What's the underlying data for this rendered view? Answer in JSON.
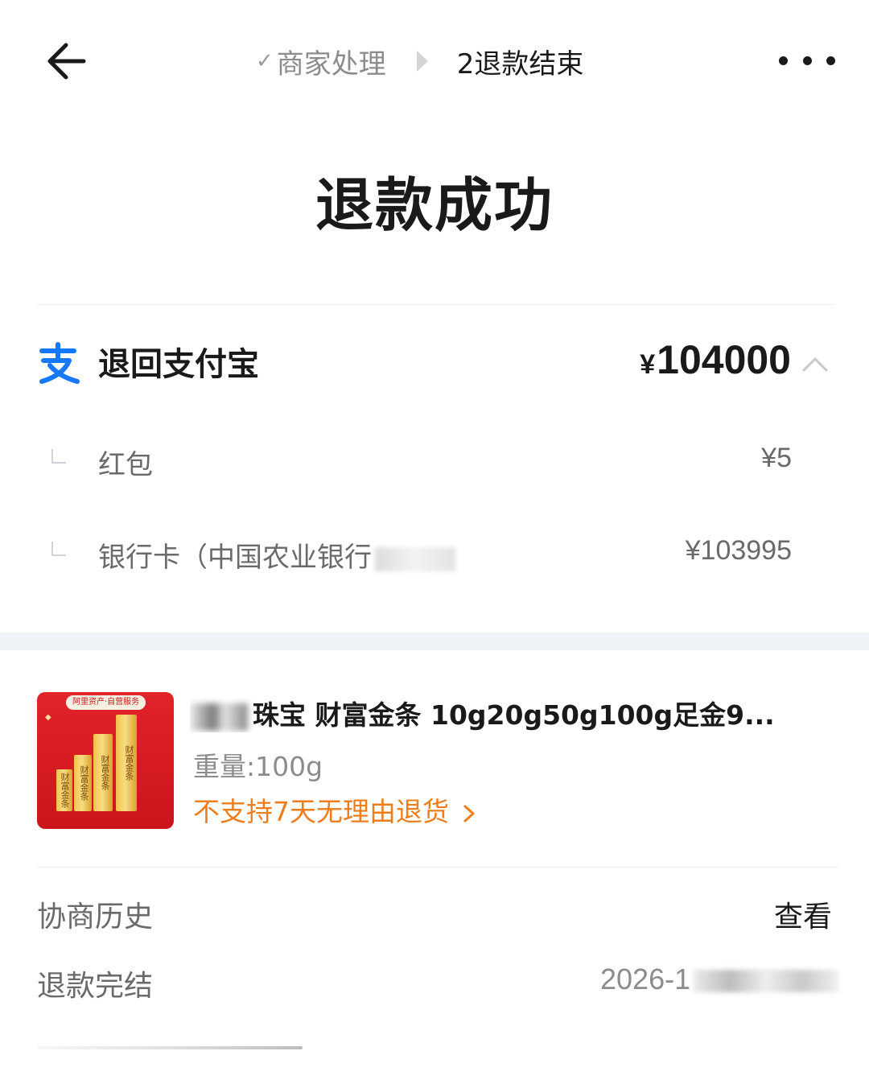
{
  "header": {
    "back_icon": "arrow-left-icon",
    "steps": [
      {
        "label": "商家处理",
        "state": "done"
      },
      {
        "label": "2退款结束",
        "state": "current"
      }
    ],
    "more_icon": "more-dots-icon"
  },
  "title": "退款成功",
  "refund": {
    "target_icon": "alipay-icon",
    "target_label": "退回支付宝",
    "currency": "¥",
    "amount": "104000",
    "breakdown": [
      {
        "label": "红包",
        "amount": "¥5"
      },
      {
        "label": "银行卡（中国农业银行",
        "amount": "¥103995"
      }
    ]
  },
  "product": {
    "title": "珠宝 财富金条 10g20g50g100g足金9...",
    "spec": "重量:100g",
    "policy": "不支持7天无理由退货",
    "image_tag": "阿里资产·自营服务",
    "image_bars": [
      "财富金条",
      "财富金条",
      "财富金条",
      "财富金条"
    ]
  },
  "history": {
    "label": "协商历史",
    "action": "查看"
  },
  "completion": {
    "label": "退款完结",
    "date": "2026-1"
  },
  "colors": {
    "accent_orange": "#ee7d1c",
    "alipay_blue": "#1677ff",
    "band_bg": "#eef3f8",
    "text_primary": "#1a1a1a",
    "text_secondary": "#6a6a6a"
  }
}
